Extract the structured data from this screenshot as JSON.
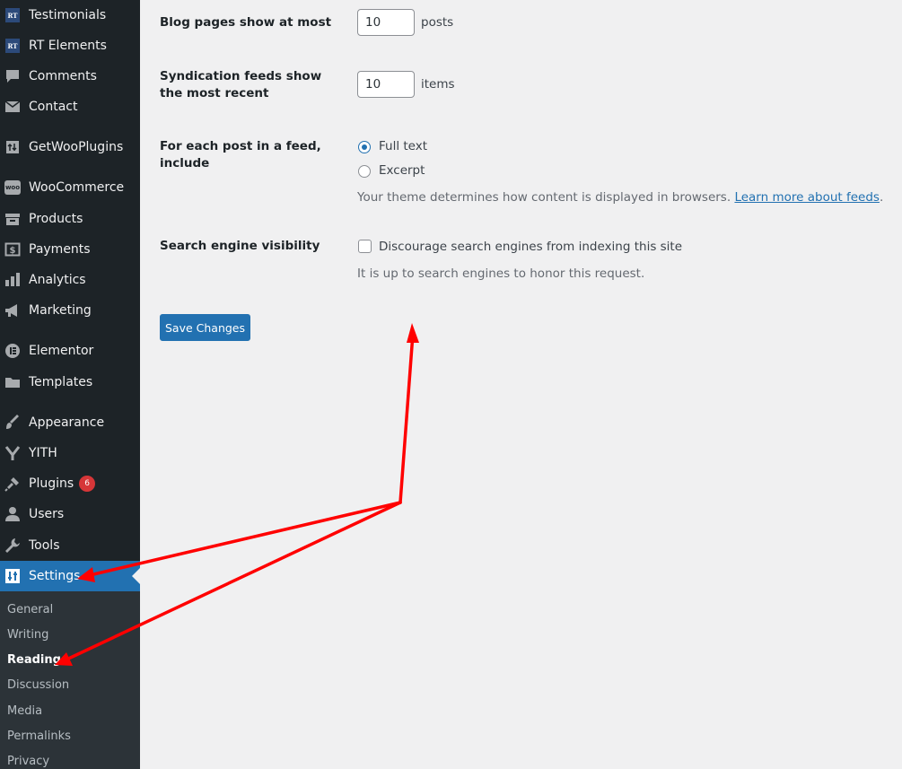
{
  "sidebar": {
    "items": [
      {
        "label": "Testimonials",
        "icon": "rt-icon"
      },
      {
        "label": "RT Elements",
        "icon": "rt-icon"
      },
      {
        "label": "Comments",
        "icon": "comment-bubble-icon"
      },
      {
        "label": "Contact",
        "icon": "envelope-icon"
      },
      {
        "label": "GetWooPlugins",
        "icon": "plugin-box-icon"
      },
      {
        "label": "WooCommerce",
        "icon": "woo-icon"
      },
      {
        "label": "Products",
        "icon": "archive-box-icon"
      },
      {
        "label": "Payments",
        "icon": "dollar-icon"
      },
      {
        "label": "Analytics",
        "icon": "bar-chart-icon"
      },
      {
        "label": "Marketing",
        "icon": "megaphone-icon"
      },
      {
        "label": "Elementor",
        "icon": "elementor-icon"
      },
      {
        "label": "Templates",
        "icon": "folder-icon"
      },
      {
        "label": "Appearance",
        "icon": "paintbrush-icon"
      },
      {
        "label": "YITH",
        "icon": "yith-icon"
      },
      {
        "label": "Plugins",
        "icon": "plug-icon",
        "badge": "6"
      },
      {
        "label": "Users",
        "icon": "user-icon"
      },
      {
        "label": "Tools",
        "icon": "wrench-icon"
      },
      {
        "label": "Settings",
        "icon": "settings-icon",
        "active": true
      }
    ],
    "rt_icon_text": "RT",
    "woo_icon_text": "woo",
    "submenu": [
      "General",
      "Writing",
      "Reading",
      "Discussion",
      "Media",
      "Permalinks",
      "Privacy"
    ],
    "submenu_current": "Reading"
  },
  "form": {
    "blog_pages": {
      "label": "Blog pages show at most",
      "value": "10",
      "unit": "posts"
    },
    "syndication": {
      "label": "Syndication feeds show the most recent",
      "value": "10",
      "unit": "items"
    },
    "feed_include": {
      "label": "For each post in a feed, include",
      "options": [
        "Full text",
        "Excerpt"
      ],
      "selected": "Full text",
      "description": "Your theme determines how content is displayed in browsers.",
      "link": "Learn more about feeds",
      "after_link": "."
    },
    "search_visibility": {
      "label": "Search engine visibility",
      "checkbox_label": "Discourage search engines from indexing this site",
      "checked": false,
      "description": "It is up to search engines to honor this request."
    },
    "save_label": "Save Changes"
  },
  "colors": {
    "sidebar_bg": "#1d2327",
    "submenu_bg": "#2c3338",
    "accent": "#2271b1",
    "annotation_arrow": "#ff0000",
    "badge": "#d63638"
  }
}
